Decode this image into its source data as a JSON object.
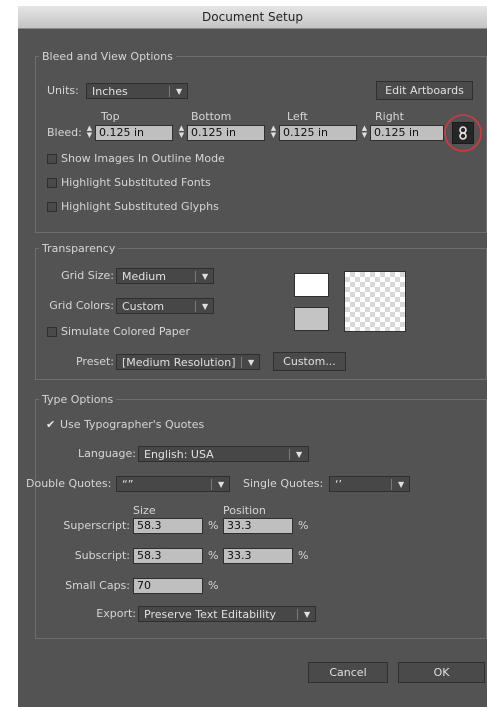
{
  "dialog": {
    "title": "Document Setup"
  },
  "bleed_view": {
    "legend": "Bleed and View Options",
    "units_label": "Units:",
    "units_value": "Inches",
    "edit_artboards": "Edit Artboards",
    "bleed_label": "Bleed:",
    "headers": {
      "top": "Top",
      "bottom": "Bottom",
      "left": "Left",
      "right": "Right"
    },
    "values": {
      "top": "0.125 in",
      "bottom": "0.125 in",
      "left": "0.125 in",
      "right": "0.125 in"
    },
    "link_icon": "chain-link-icon",
    "highlight_color": "#e0343c",
    "checkboxes": [
      {
        "label": "Show Images In Outline Mode",
        "checked": false
      },
      {
        "label": "Highlight Substituted Fonts",
        "checked": false
      },
      {
        "label": "Highlight Substituted Glyphs",
        "checked": false
      }
    ]
  },
  "transparency": {
    "legend": "Transparency",
    "grid_size_label": "Grid Size:",
    "grid_size_value": "Medium",
    "grid_colors_label": "Grid Colors:",
    "grid_colors_value": "Custom",
    "simulate_label": "Simulate Colored Paper",
    "preset_label": "Preset:",
    "preset_value": "[Medium Resolution]",
    "custom_button": "Custom...",
    "swatch_top": "#ffffff",
    "swatch_bottom": "#c4c4c4"
  },
  "type_options": {
    "legend": "Type Options",
    "typographers_quotes_label": "Use Typographer's Quotes",
    "typographers_quotes_checked": true,
    "language_label": "Language:",
    "language_value": "English: USA",
    "double_quotes_label": "Double Quotes:",
    "double_quotes_value": "“”",
    "single_quotes_label": "Single Quotes:",
    "single_quotes_value": "‘’",
    "size_header": "Size",
    "position_header": "Position",
    "superscript_label": "Superscript:",
    "superscript_size": "58.3",
    "superscript_position": "33.3",
    "subscript_label": "Subscript:",
    "subscript_size": "58.3",
    "subscript_position": "33.3",
    "small_caps_label": "Small Caps:",
    "small_caps_value": "70",
    "percent": "%",
    "export_label": "Export:",
    "export_value": "Preserve Text Editability"
  },
  "footer": {
    "cancel": "Cancel",
    "ok": "OK"
  }
}
